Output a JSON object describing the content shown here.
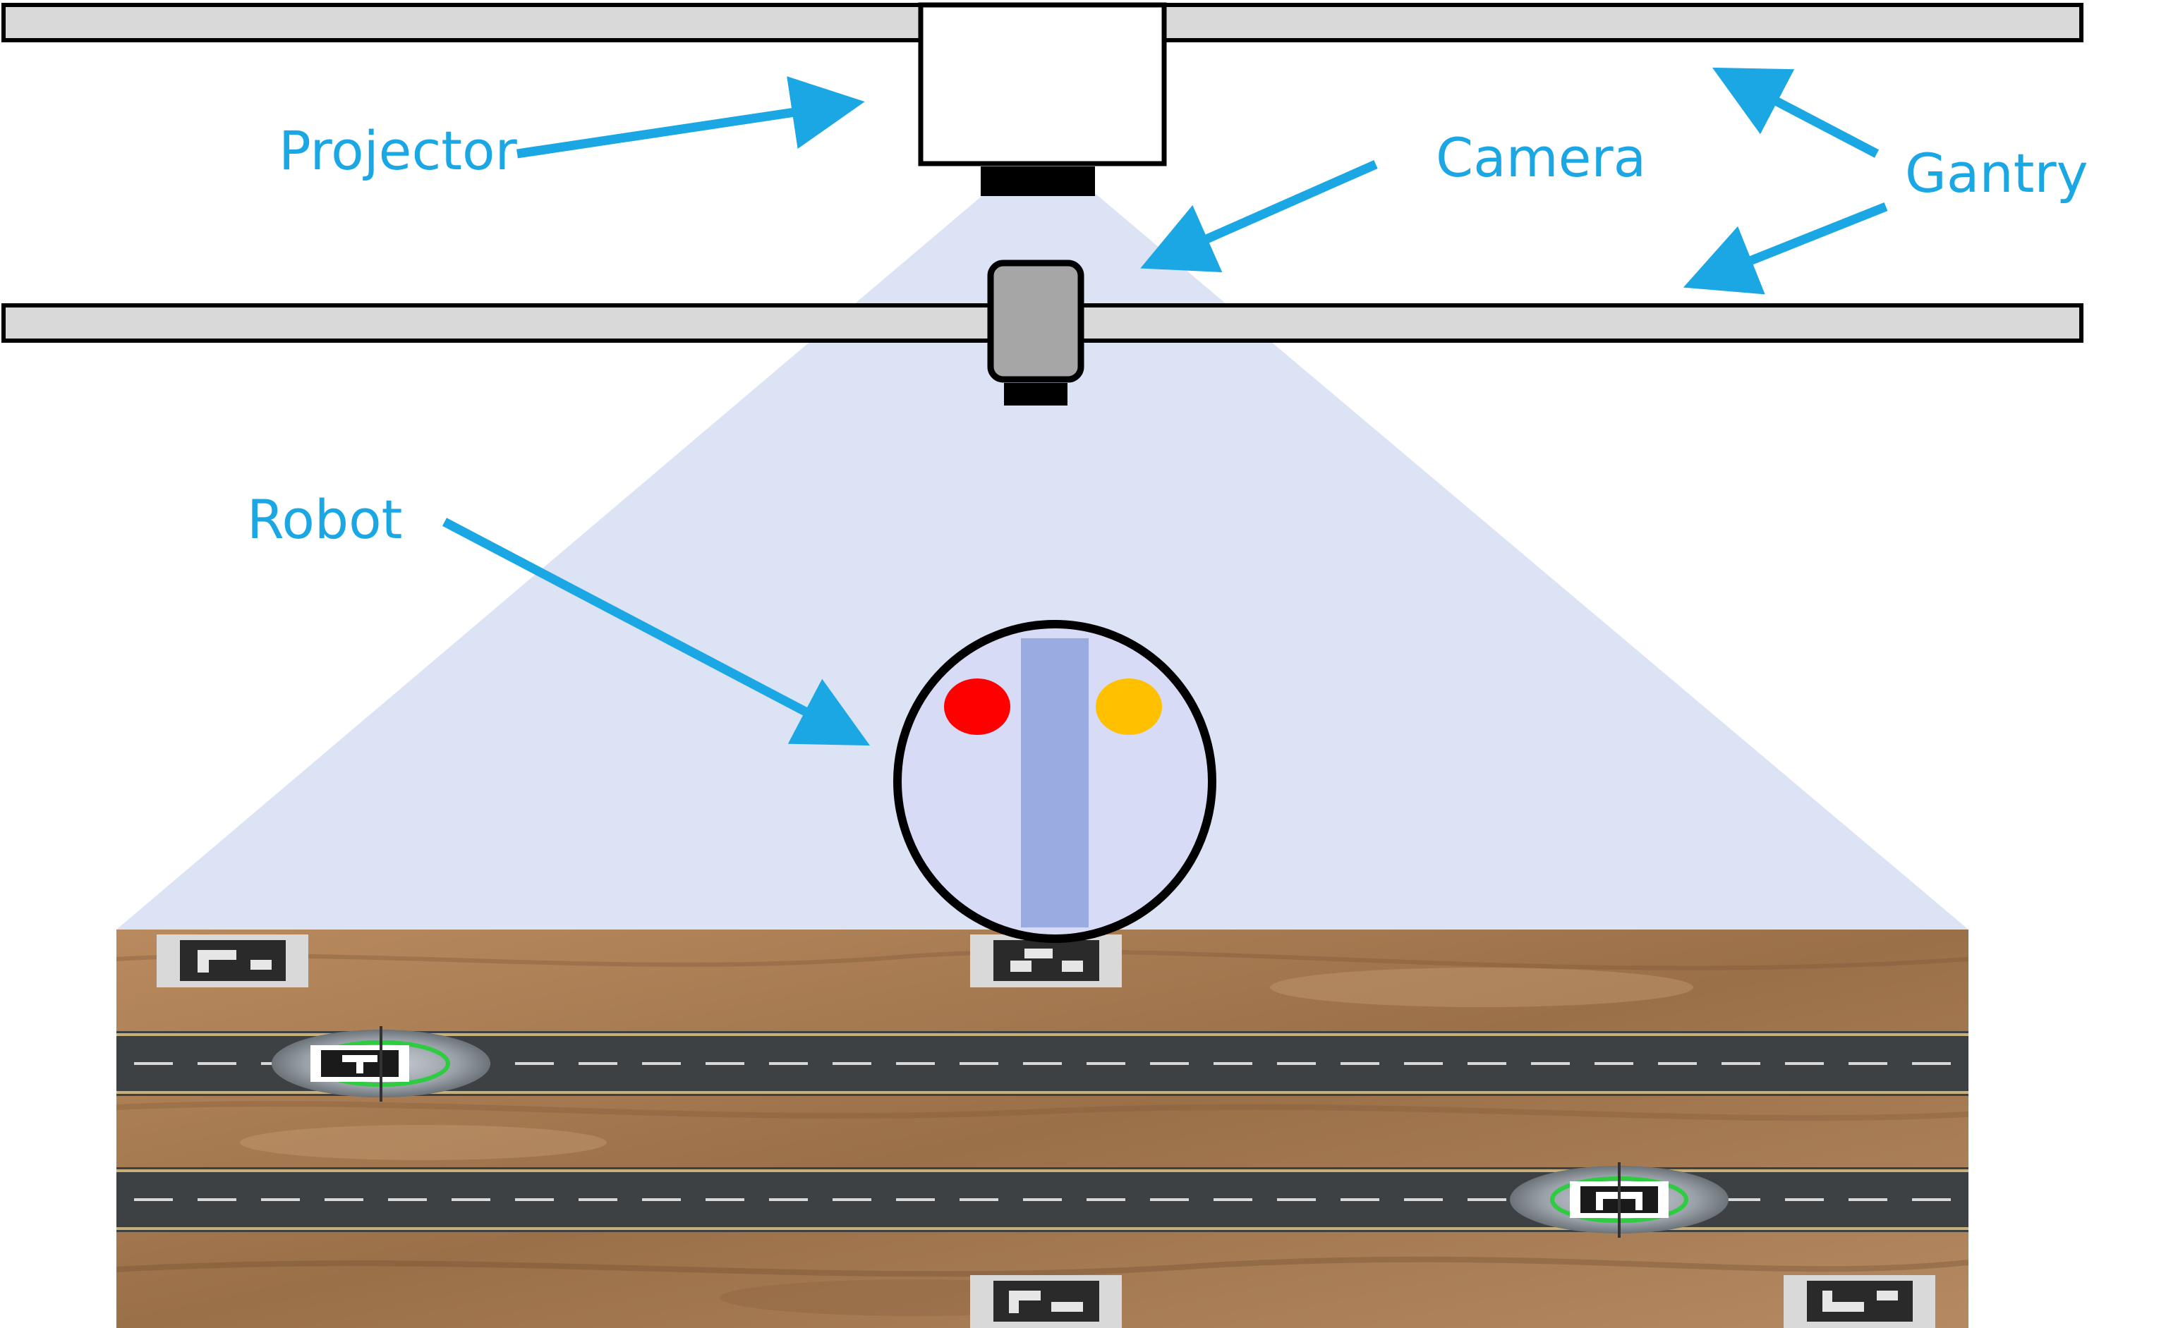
{
  "labels": {
    "projector": "Projector",
    "camera": "Camera",
    "gantry": "Gantry",
    "robot": "Robot"
  },
  "colors": {
    "accent": "#1aa7e4",
    "rail": "#d9d9d9",
    "cone": "#dbe3f4",
    "camera_body": "#a6a6a6",
    "robot_body": "#d7dbf5",
    "robot_stripe": "#9aabe2",
    "robot_led_left": "#ff0000",
    "robot_led_right": "#ffc000",
    "terrain": "#a57a52",
    "road": "#3e4144"
  },
  "icons": {
    "projector": "projector-box-icon",
    "camera": "camera-icon",
    "robot": "robot-circle-icon",
    "marker": "aruco-marker-icon"
  }
}
